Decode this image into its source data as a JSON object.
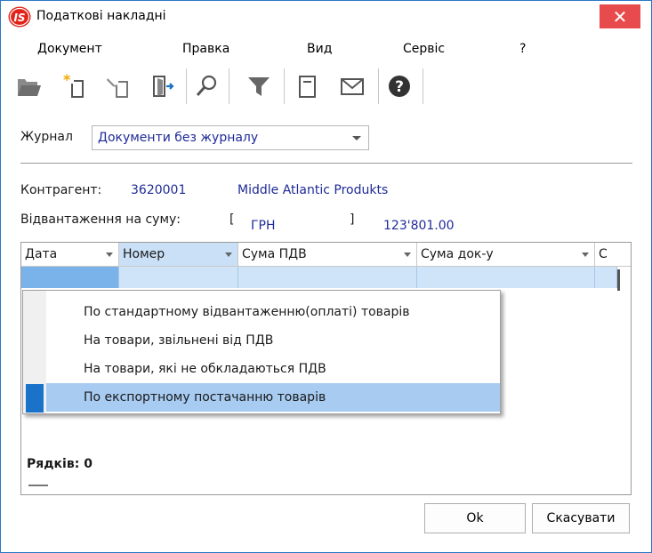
{
  "window": {
    "title": "Податкові накладні",
    "logo_text": "IS",
    "close_glyph": "✕"
  },
  "menu": [
    {
      "label": "Документ"
    },
    {
      "label": "Правка"
    },
    {
      "label": "Вид"
    },
    {
      "label": "Сервіс"
    },
    {
      "label": "?"
    }
  ],
  "toolbar": {
    "icons": [
      "open-folder-icon",
      "new-document-icon",
      "edit-document-icon",
      "exit-icon",
      "search-icon",
      "filter-icon",
      "form-icon",
      "mail-icon",
      "help-icon"
    ]
  },
  "journal": {
    "label": "Журнал",
    "value": "Документи без журналу"
  },
  "contractor": {
    "label": "Контрагент:",
    "code": "3620001",
    "name": "Middle Atlantic Produkts"
  },
  "shipment": {
    "label": "Відвантаження на суму:",
    "bracket_open": "[",
    "currency": "ГРН",
    "bracket_close": "]",
    "amount": "123'801.00"
  },
  "grid": {
    "columns": [
      {
        "label": "Дата"
      },
      {
        "label": "Номер"
      },
      {
        "label": "Сума ПДВ"
      },
      {
        "label": "Сума  док-у"
      },
      {
        "label": "С"
      }
    ],
    "rows_label": "Рядків: 0"
  },
  "popup_menu": {
    "items": [
      {
        "label": "По стандартному відвантаженню(оплаті) товарів"
      },
      {
        "label": "На товари, звільнені від ПДВ"
      },
      {
        "label": "На товари, які не обкладаються ПДВ"
      },
      {
        "label": "По експортному  постачанню товарів"
      }
    ],
    "selected_index": 3
  },
  "buttons": {
    "ok": "Ok",
    "cancel": "Скасувати"
  },
  "colors": {
    "accent": "#1a73c8",
    "selection": "#a7cbf1",
    "close": "#e84b4b",
    "value_text": "#1f2b98"
  }
}
